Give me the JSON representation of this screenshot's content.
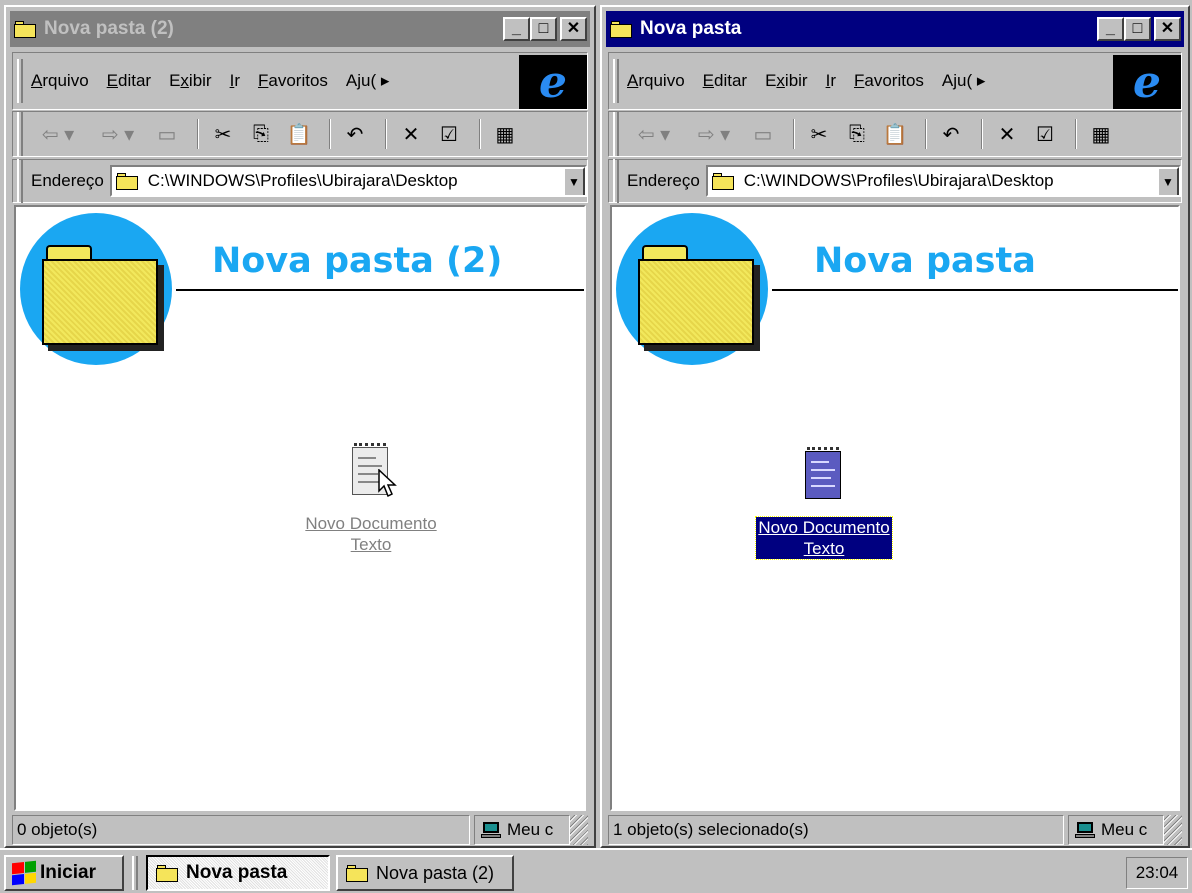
{
  "windows": {
    "left": {
      "title": "Nova pasta (2)",
      "active": false,
      "folder_heading": "Nova pasta (2)",
      "file_label_line1": "Novo Documento",
      "file_label_line2": "Texto",
      "status_text": "0 objeto(s)",
      "status_zone": "Meu c"
    },
    "right": {
      "title": "Nova pasta",
      "active": true,
      "folder_heading": "Nova pasta",
      "file_label_line1": "Novo Documento",
      "file_label_line2": "Texto",
      "status_text": "1 objeto(s) selecionado(s)",
      "status_zone": "Meu c"
    }
  },
  "title_buttons": {
    "minimize": "_",
    "maximize": "□",
    "close": "✕"
  },
  "menu": {
    "arquivo_u": "A",
    "arquivo_rest": "rquivo",
    "editar_u": "E",
    "editar_rest": "ditar",
    "exibir_pre": "E",
    "exibir_u": "x",
    "exibir_rest": "ibir",
    "ir_u": "I",
    "ir_rest": "r",
    "favoritos_u": "F",
    "favoritos_rest": "avoritos",
    "ajuda": "Aju( ▸"
  },
  "ie_logo": "e",
  "toolbar_icons": {
    "back": "⇦ ▾",
    "forward": "⇨ ▾",
    "up": "▭",
    "cut": "✂",
    "copy": "⎘",
    "paste": "📋",
    "undo": "↶",
    "delete": "✕",
    "properties": "☑",
    "views": "▦"
  },
  "address": {
    "label": "Endereço",
    "value": "C:\\WINDOWS\\Profiles\\Ubirajara\\Desktop",
    "dropdown": "▼"
  },
  "taskbar": {
    "start_label": "Iniciar",
    "tasks": [
      "Nova pasta",
      "Nova pasta (2)"
    ],
    "clock": "23:04"
  },
  "colors": {
    "active_title": "#000080",
    "inactive_title": "#808080",
    "heading_blue": "#1aa7f2",
    "folder_yellow": "#f2e85c",
    "windows_logo": [
      "#ff0000",
      "#00a000",
      "#0000ff",
      "#ffd700"
    ]
  }
}
